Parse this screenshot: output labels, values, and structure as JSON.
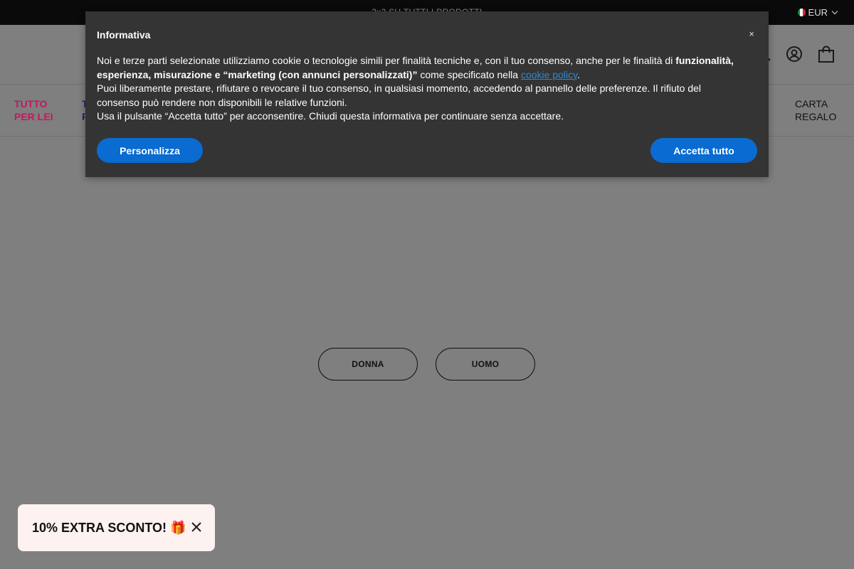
{
  "announcement": {
    "text": "3x2 SU TUTTI I PRODOTTI"
  },
  "currency": {
    "label": "EUR"
  },
  "nav": {
    "lei": {
      "line1": "TUTTO",
      "line2": "PER LEI"
    },
    "lui": {
      "line1": "T",
      "line2": "P"
    },
    "gift": {
      "line1": "CARTA",
      "line2": "REGALO"
    }
  },
  "header": {
    "icons": [
      "search-icon",
      "account-icon",
      "cart-icon"
    ]
  },
  "hero": {
    "donna": "DONNA",
    "uomo": "UOMO"
  },
  "cookie": {
    "title": "Informativa",
    "close": "×",
    "p1_a": "Noi e terze parti selezionate utilizziamo cookie o tecnologie simili per finalità tecniche e, con il tuo consenso, anche per le finalità di ",
    "p1_bold": "funzionalità, esperienza, misurazione e “marketing (con annunci personalizzati)”",
    "p1_b": " come specificato nella ",
    "p1_link": "cookie policy",
    "p1_end": ".",
    "p2": "Puoi liberamente prestare, rifiutare o revocare il tuo consenso, in qualsiasi momento, accedendo al pannello delle preferenze. Il rifiuto del consenso può rendere non disponibili le relative funzioni.",
    "p3": "Usa il pulsante “Accetta tutto” per acconsentire. Chiudi questa informativa per continuare senza accettare.",
    "customize": "Personalizza",
    "accept": "Accetta tutto"
  },
  "promo": {
    "text": "10% EXTRA SCONTO! 🎁"
  },
  "colors": {
    "accent_blue": "#0a6bd1",
    "lei_pink": "#c01a5e",
    "lui_navy": "#1c2a73",
    "overlay_gray": "#7f7f7f"
  }
}
